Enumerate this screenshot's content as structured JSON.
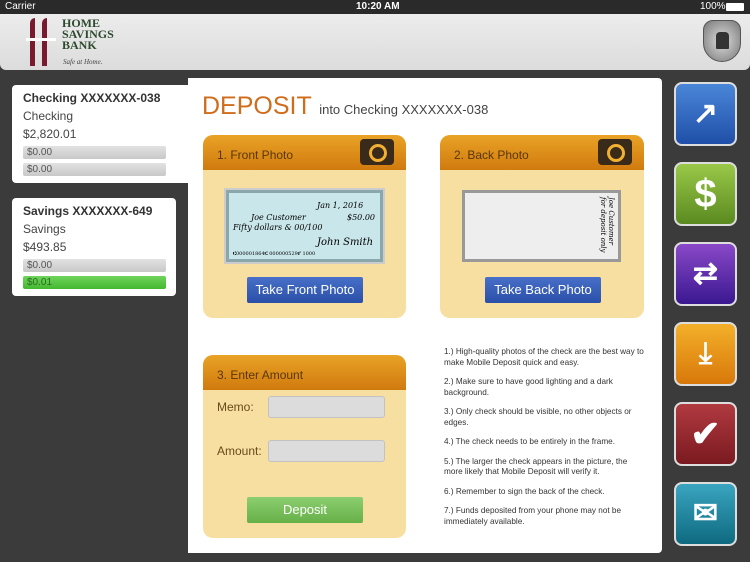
{
  "status": {
    "carrier": "Carrier",
    "time": "10:20 AM",
    "battery": "100%"
  },
  "logo": {
    "line1": "HOME",
    "line2": "SAVINGS",
    "line3": "BANK",
    "tagline": "Safe at Home."
  },
  "accounts": [
    {
      "title": "Checking XXXXXXX-038",
      "type": "Checking",
      "balance": "$2,820.01",
      "bars": [
        "$0.00",
        "$0.00"
      ]
    },
    {
      "title": "Savings XXXXXXX-649",
      "type": "Savings",
      "balance": "$493.85",
      "bars": [
        "$0.00",
        "$0.01"
      ]
    }
  ],
  "deposit": {
    "title": "DEPOSIT",
    "subtitle": "into Checking XXXXXXX-038",
    "front": {
      "header": "1. Front Photo",
      "button": "Take Front Photo"
    },
    "back": {
      "header": "2. Back Photo",
      "button": "Take Back Photo"
    },
    "amount": {
      "header": "3. Enter Amount",
      "memo_label": "Memo:",
      "memo_value": "",
      "amount_label": "Amount:",
      "amount_value": "",
      "button": "Deposit"
    },
    "check": {
      "date": "Jan 1, 2016",
      "payee": "Joe Customer",
      "amount": "$50.00",
      "words": "Fifty dollars & 00/100",
      "signature": "John Smith",
      "micr": "⑆000001864⑆ 000000529⑈ 1000",
      "endorse": "Joe Customer for deposit only"
    },
    "tips": [
      "1.) High-quality photos of the check are the best way to make Mobile Deposit quick and easy.",
      "2.) Make sure to have good lighting and a dark background.",
      "3.) Only check should be visible, no other objects or edges.",
      "4.) The check needs to be entirely in the frame.",
      "5.) The larger the check appears in the picture, the more likely that Mobile Deposit will verify it.",
      "6.) Remember to sign the back of the check.",
      "7.) Funds deposited from your phone may not be immediately available."
    ]
  },
  "nav": [
    {
      "icon": "accounts-chart-icon",
      "color": "#2a5fb8"
    },
    {
      "icon": "dollar-pay-icon",
      "color": "#6a9a2a"
    },
    {
      "icon": "transfer-icon",
      "color": "#5a2aa0"
    },
    {
      "icon": "deposit-icon",
      "color": "#e08a10"
    },
    {
      "icon": "checkmark-icon",
      "color": "#8a2228"
    },
    {
      "icon": "contact-icon",
      "color": "#1a7a90"
    }
  ]
}
